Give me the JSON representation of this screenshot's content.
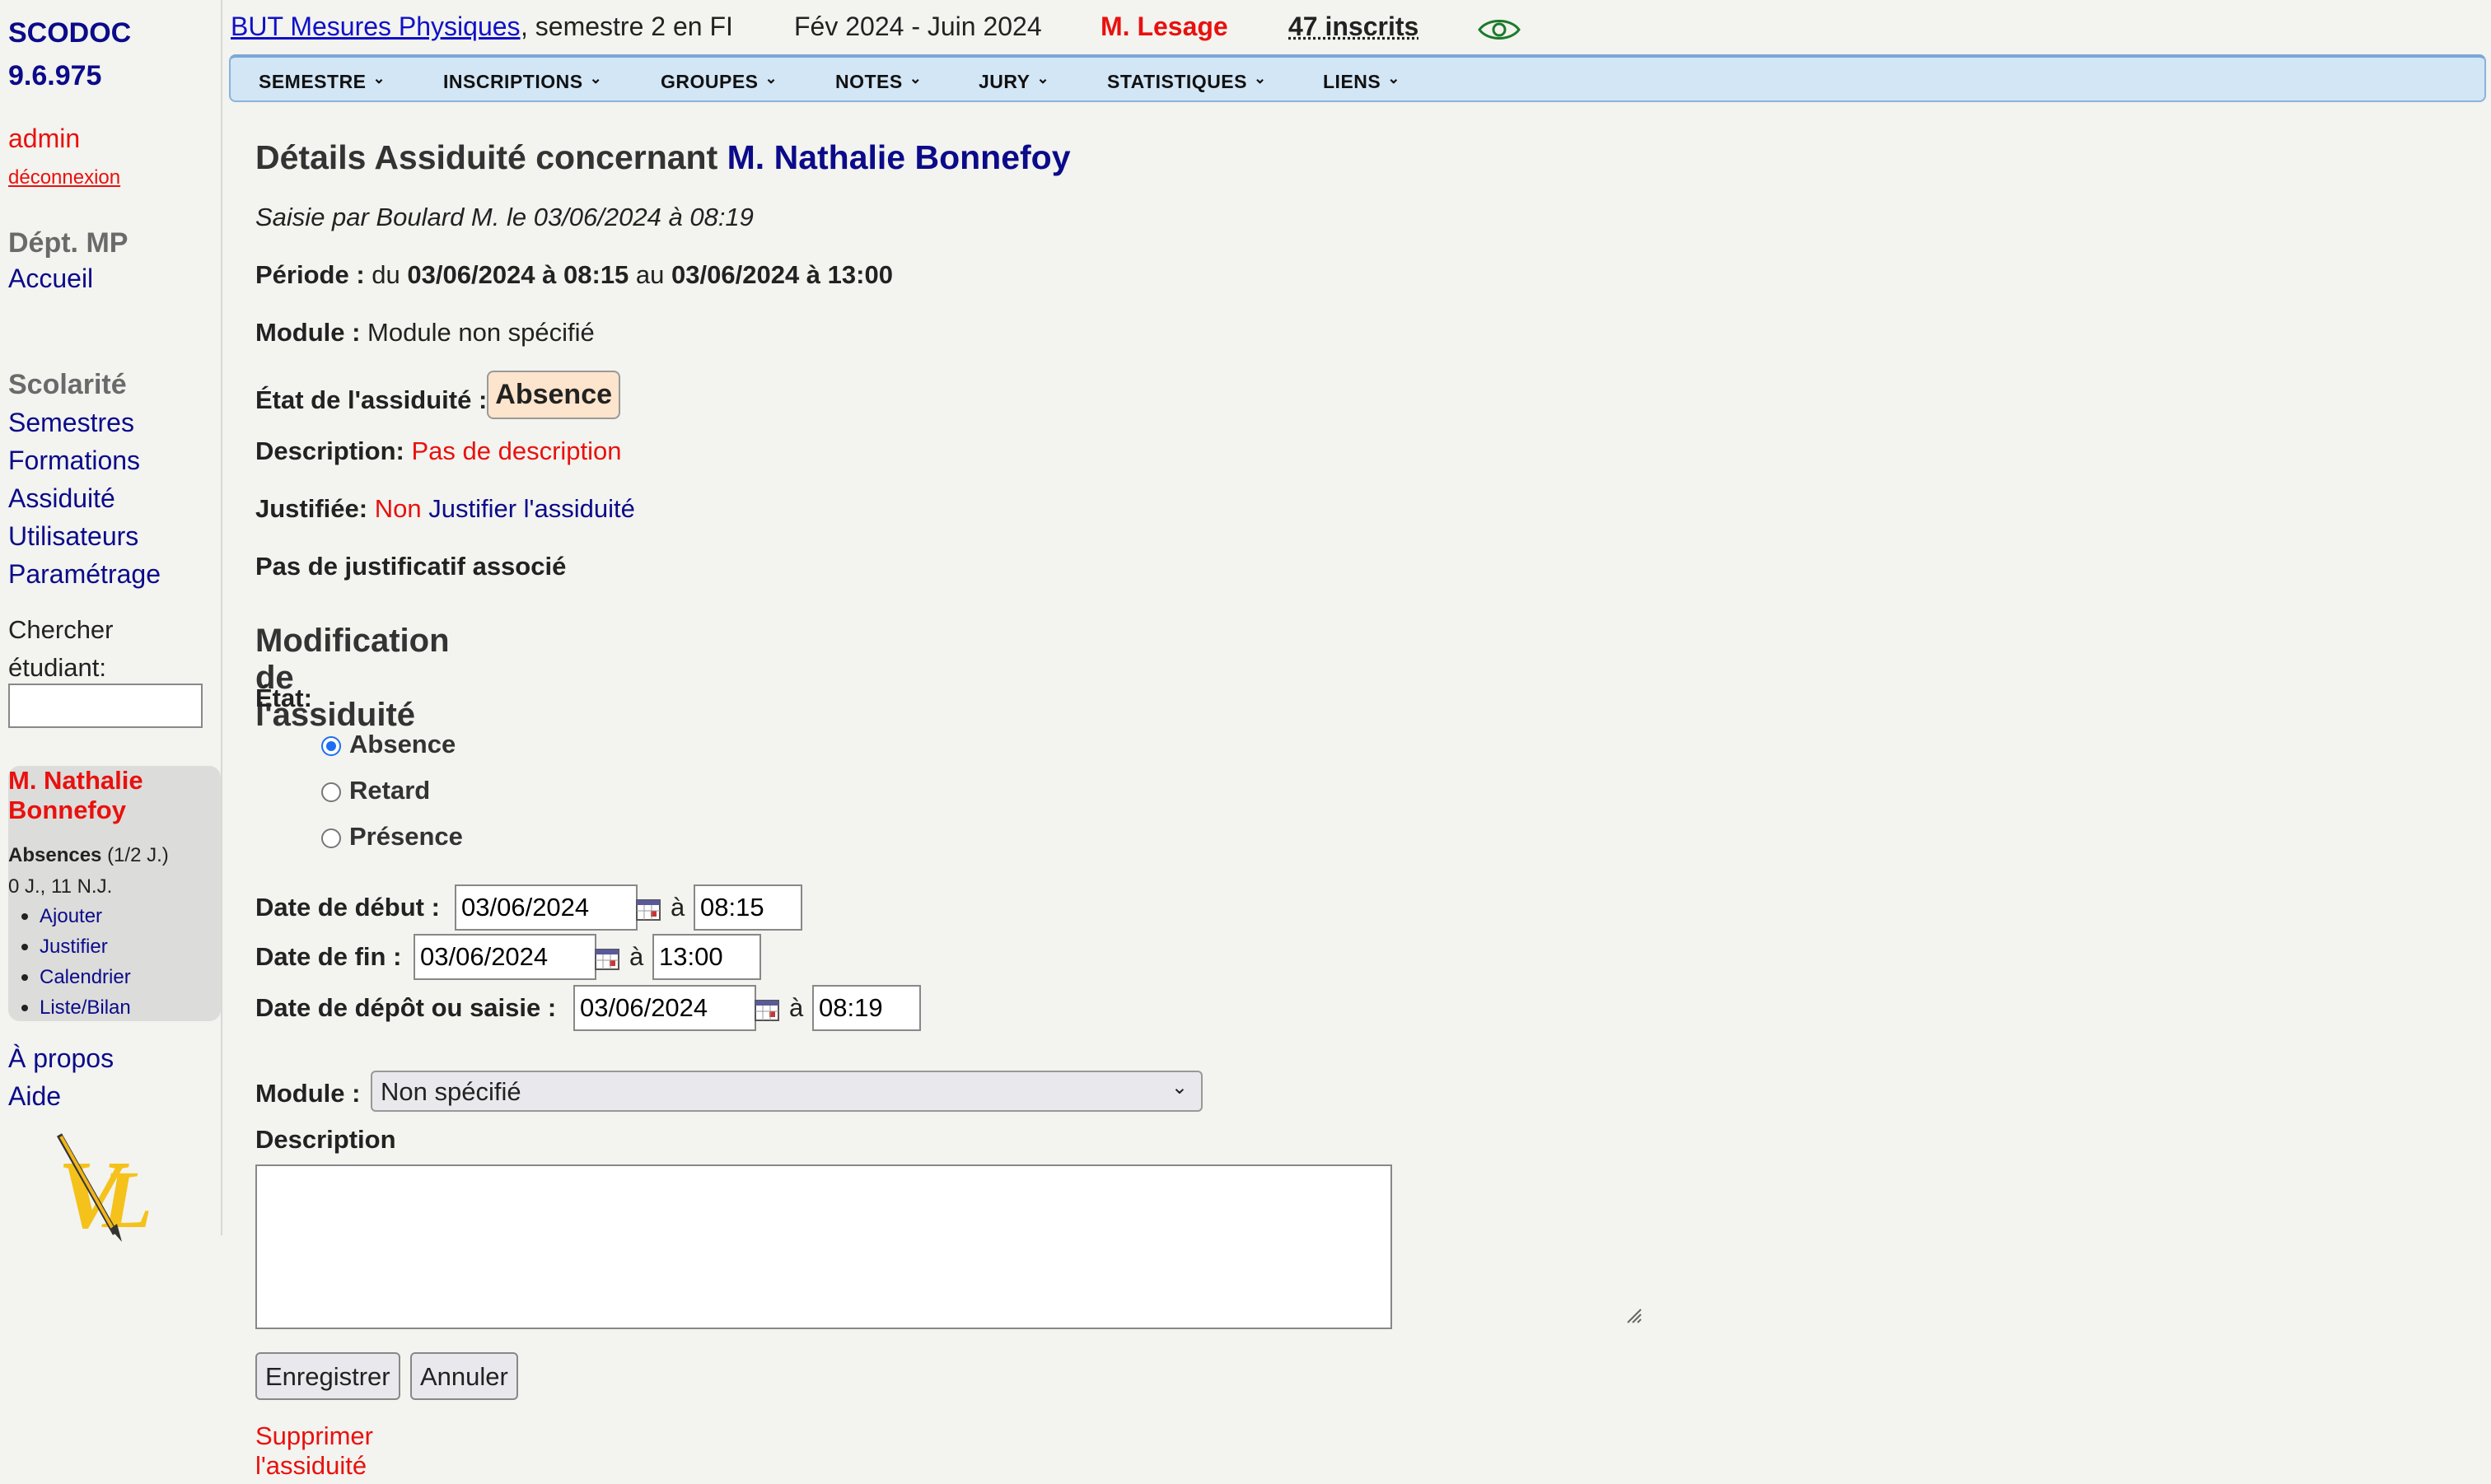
{
  "sidebar": {
    "app_name": "SCODOC",
    "version": "9.6.975",
    "user": "admin",
    "logout": "déconnexion",
    "dept": "Dépt. MP",
    "accueil": "Accueil",
    "scolarite": "Scolarité",
    "links": [
      "Semestres",
      "Formations",
      "Assiduité",
      "Utilisateurs",
      "Paramétrage"
    ],
    "search_label": "Chercher étudiant:",
    "search_value": "",
    "student": {
      "name": "M. Nathalie Bonnefoy",
      "absences_label": "Absences",
      "absences_unit": "(1/2 J.)",
      "absences_counts": "0 J., 11 N.J.",
      "links": [
        "Ajouter",
        "Justifier",
        "Calendrier",
        "Liste/Bilan"
      ]
    },
    "about": "À propos",
    "help": "Aide"
  },
  "topbar": {
    "formation": "BUT Mesures Physiques",
    "semestre": ", semestre 2 en FI",
    "dates": "Fév 2024 - Juin 2024",
    "responsable": "M. Lesage",
    "inscrits": "47 inscrits"
  },
  "menu": [
    "SEMESTRE",
    "INSCRIPTIONS",
    "GROUPES",
    "NOTES",
    "JURY",
    "STATISTIQUES",
    "LIENS"
  ],
  "details": {
    "title_prefix": "Détails Assiduité concernant",
    "student": "M. Nathalie Bonnefoy",
    "saisie": "Saisie par Boulard M. le 03/06/2024 à 08:19",
    "periode_label": "Période :",
    "du": "du",
    "start": "03/06/2024 à 08:15",
    "au": "au",
    "end": "03/06/2024 à 13:00",
    "module_label": "Module :",
    "module_value": "Module non spécifié",
    "etat_label": "État de l'assiduité :",
    "etat_value": "Absence",
    "description_label": "Description:",
    "description_value": "Pas de description",
    "justifiee_label": "Justifiée:",
    "justifiee_value": "Non",
    "justifier_link": "Justifier l'assiduité",
    "justificatif": "Pas de justificatif associé"
  },
  "form": {
    "title": "Modification de l'assiduité",
    "etat_label": "État:",
    "options": [
      "Absence",
      "Retard",
      "Présence"
    ],
    "selected": "Absence",
    "a": "à",
    "date_debut_label": "Date de début :",
    "date_debut": "03/06/2024",
    "heure_debut": "08:15",
    "date_fin_label": "Date de fin :",
    "date_fin": "03/06/2024",
    "heure_fin": "13:00",
    "date_depot_label": "Date de dépôt ou saisie :",
    "date_depot": "03/06/2024",
    "heure_depot": "08:19",
    "module_label": "Module :",
    "module_value": "Non spécifié",
    "description_label": "Description",
    "description_value": "",
    "save": "Enregistrer",
    "cancel": "Annuler",
    "delete": "Supprimer l'assiduité"
  },
  "colors": {
    "accent_blue": "#0b0b8a",
    "alert_red": "#e8110e",
    "menubar": "#d3e6f6",
    "absence_badge": "#fde4cc"
  }
}
